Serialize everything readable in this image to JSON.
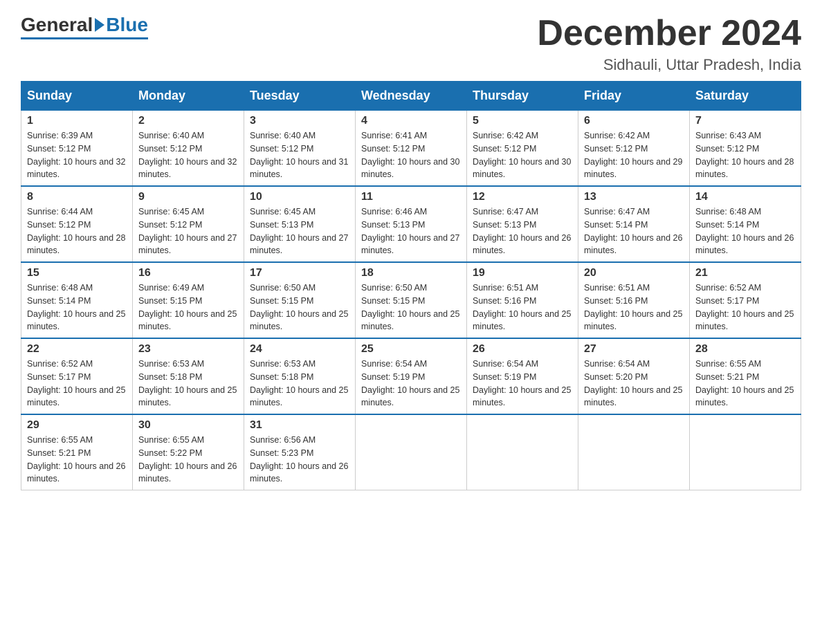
{
  "header": {
    "logo_general": "General",
    "logo_blue": "Blue",
    "month_title": "December 2024",
    "location": "Sidhauli, Uttar Pradesh, India"
  },
  "days_of_week": [
    "Sunday",
    "Monday",
    "Tuesday",
    "Wednesday",
    "Thursday",
    "Friday",
    "Saturday"
  ],
  "weeks": [
    [
      {
        "day": "1",
        "sunrise": "6:39 AM",
        "sunset": "5:12 PM",
        "daylight": "10 hours and 32 minutes."
      },
      {
        "day": "2",
        "sunrise": "6:40 AM",
        "sunset": "5:12 PM",
        "daylight": "10 hours and 32 minutes."
      },
      {
        "day": "3",
        "sunrise": "6:40 AM",
        "sunset": "5:12 PM",
        "daylight": "10 hours and 31 minutes."
      },
      {
        "day": "4",
        "sunrise": "6:41 AM",
        "sunset": "5:12 PM",
        "daylight": "10 hours and 30 minutes."
      },
      {
        "day": "5",
        "sunrise": "6:42 AM",
        "sunset": "5:12 PM",
        "daylight": "10 hours and 30 minutes."
      },
      {
        "day": "6",
        "sunrise": "6:42 AM",
        "sunset": "5:12 PM",
        "daylight": "10 hours and 29 minutes."
      },
      {
        "day": "7",
        "sunrise": "6:43 AM",
        "sunset": "5:12 PM",
        "daylight": "10 hours and 28 minutes."
      }
    ],
    [
      {
        "day": "8",
        "sunrise": "6:44 AM",
        "sunset": "5:12 PM",
        "daylight": "10 hours and 28 minutes."
      },
      {
        "day": "9",
        "sunrise": "6:45 AM",
        "sunset": "5:12 PM",
        "daylight": "10 hours and 27 minutes."
      },
      {
        "day": "10",
        "sunrise": "6:45 AM",
        "sunset": "5:13 PM",
        "daylight": "10 hours and 27 minutes."
      },
      {
        "day": "11",
        "sunrise": "6:46 AM",
        "sunset": "5:13 PM",
        "daylight": "10 hours and 27 minutes."
      },
      {
        "day": "12",
        "sunrise": "6:47 AM",
        "sunset": "5:13 PM",
        "daylight": "10 hours and 26 minutes."
      },
      {
        "day": "13",
        "sunrise": "6:47 AM",
        "sunset": "5:14 PM",
        "daylight": "10 hours and 26 minutes."
      },
      {
        "day": "14",
        "sunrise": "6:48 AM",
        "sunset": "5:14 PM",
        "daylight": "10 hours and 26 minutes."
      }
    ],
    [
      {
        "day": "15",
        "sunrise": "6:48 AM",
        "sunset": "5:14 PM",
        "daylight": "10 hours and 25 minutes."
      },
      {
        "day": "16",
        "sunrise": "6:49 AM",
        "sunset": "5:15 PM",
        "daylight": "10 hours and 25 minutes."
      },
      {
        "day": "17",
        "sunrise": "6:50 AM",
        "sunset": "5:15 PM",
        "daylight": "10 hours and 25 minutes."
      },
      {
        "day": "18",
        "sunrise": "6:50 AM",
        "sunset": "5:15 PM",
        "daylight": "10 hours and 25 minutes."
      },
      {
        "day": "19",
        "sunrise": "6:51 AM",
        "sunset": "5:16 PM",
        "daylight": "10 hours and 25 minutes."
      },
      {
        "day": "20",
        "sunrise": "6:51 AM",
        "sunset": "5:16 PM",
        "daylight": "10 hours and 25 minutes."
      },
      {
        "day": "21",
        "sunrise": "6:52 AM",
        "sunset": "5:17 PM",
        "daylight": "10 hours and 25 minutes."
      }
    ],
    [
      {
        "day": "22",
        "sunrise": "6:52 AM",
        "sunset": "5:17 PM",
        "daylight": "10 hours and 25 minutes."
      },
      {
        "day": "23",
        "sunrise": "6:53 AM",
        "sunset": "5:18 PM",
        "daylight": "10 hours and 25 minutes."
      },
      {
        "day": "24",
        "sunrise": "6:53 AM",
        "sunset": "5:18 PM",
        "daylight": "10 hours and 25 minutes."
      },
      {
        "day": "25",
        "sunrise": "6:54 AM",
        "sunset": "5:19 PM",
        "daylight": "10 hours and 25 minutes."
      },
      {
        "day": "26",
        "sunrise": "6:54 AM",
        "sunset": "5:19 PM",
        "daylight": "10 hours and 25 minutes."
      },
      {
        "day": "27",
        "sunrise": "6:54 AM",
        "sunset": "5:20 PM",
        "daylight": "10 hours and 25 minutes."
      },
      {
        "day": "28",
        "sunrise": "6:55 AM",
        "sunset": "5:21 PM",
        "daylight": "10 hours and 25 minutes."
      }
    ],
    [
      {
        "day": "29",
        "sunrise": "6:55 AM",
        "sunset": "5:21 PM",
        "daylight": "10 hours and 26 minutes."
      },
      {
        "day": "30",
        "sunrise": "6:55 AM",
        "sunset": "5:22 PM",
        "daylight": "10 hours and 26 minutes."
      },
      {
        "day": "31",
        "sunrise": "6:56 AM",
        "sunset": "5:23 PM",
        "daylight": "10 hours and 26 minutes."
      },
      null,
      null,
      null,
      null
    ]
  ],
  "labels": {
    "sunrise_prefix": "Sunrise: ",
    "sunset_prefix": "Sunset: ",
    "daylight_prefix": "Daylight: "
  }
}
